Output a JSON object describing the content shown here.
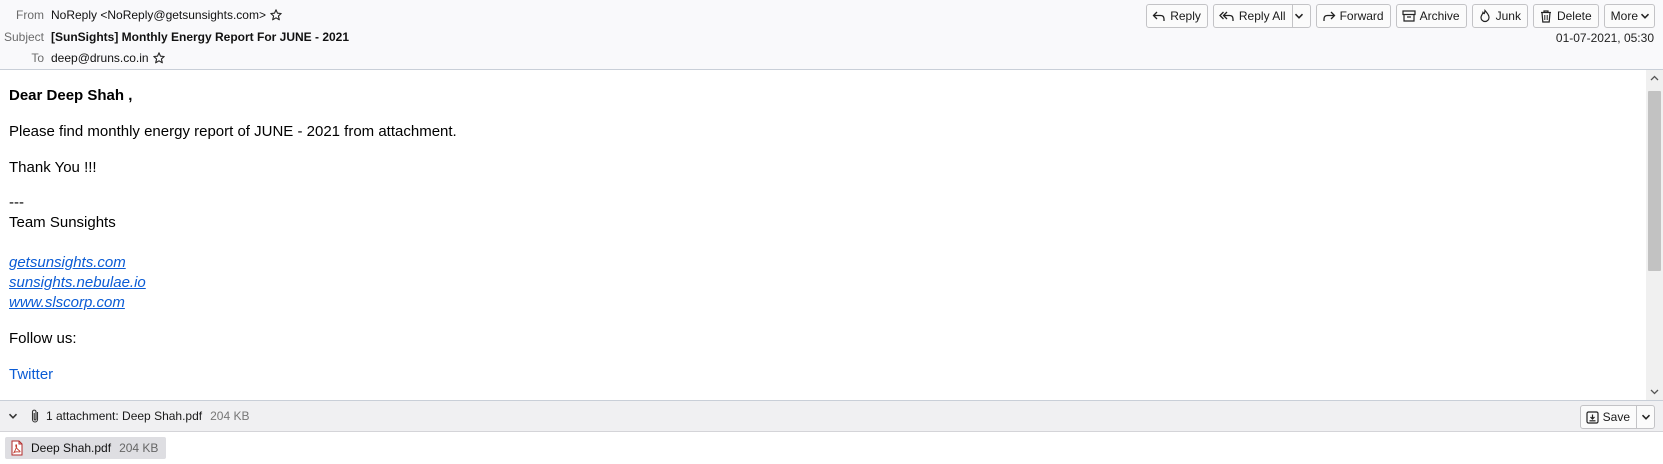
{
  "header": {
    "from_label": "From",
    "from_value": "NoReply <NoReply@getsunsights.com>",
    "subject_label": "Subject",
    "subject_value": "[SunSights] Monthly Energy Report For JUNE - 2021",
    "to_label": "To",
    "to_value": "deep@druns.co.in",
    "date": "01-07-2021, 05:30"
  },
  "toolbar": {
    "reply": "Reply",
    "reply_all": "Reply All",
    "forward": "Forward",
    "archive": "Archive",
    "junk": "Junk",
    "delete": "Delete",
    "more": "More"
  },
  "message": {
    "greeting": "Dear Deep Shah ,",
    "line1": "Please find monthly energy report of JUNE - 2021 from attachment.",
    "thanks": "Thank You !!!",
    "separator": "---",
    "team": "Team Sunsights",
    "links": [
      "getsunsights.com",
      "sunsights.nebulae.io",
      "www.slscorp.com"
    ],
    "follow": "Follow us:",
    "twitter": "Twitter"
  },
  "attachments": {
    "summary_label": "1 attachment: Deep Shah.pdf",
    "summary_size": "204 KB",
    "save": "Save",
    "items": [
      {
        "name": "Deep Shah.pdf",
        "size": "204 KB",
        "icon": "pdf-file-icon"
      }
    ]
  },
  "colors": {
    "link": "#0b5cd5",
    "header_bg": "#f9f9fb",
    "attachment_bar_bg": "#f0f0f2"
  }
}
